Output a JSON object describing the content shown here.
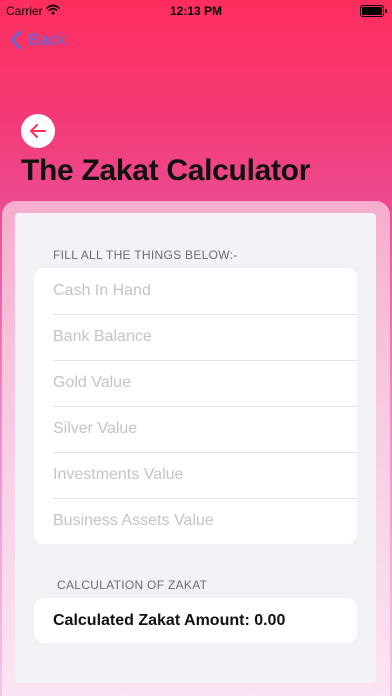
{
  "status_bar": {
    "carrier": "Carrier",
    "time": "12:13 PM"
  },
  "nav": {
    "back_label": "Back"
  },
  "page": {
    "title": "The Zakat Calculator"
  },
  "form": {
    "section_header": "FILL ALL THE THINGS BELOW:-",
    "fields": [
      {
        "placeholder": "Cash In Hand",
        "value": ""
      },
      {
        "placeholder": "Bank Balance",
        "value": ""
      },
      {
        "placeholder": "Gold Value",
        "value": ""
      },
      {
        "placeholder": "Silver Value",
        "value": ""
      },
      {
        "placeholder": "Investments Value",
        "value": ""
      },
      {
        "placeholder": "Business Assets Value",
        "value": ""
      }
    ]
  },
  "calculation": {
    "section_header": "CALCULATION OF ZAKAT",
    "result_label": "Calculated Zakat Amount: 0.00"
  },
  "colors": {
    "accent": "#ff2d5e",
    "nav_tint": "#5a6de0"
  },
  "icons": {
    "nav_back": "chevron-left-icon",
    "round_back": "arrow-left-icon"
  }
}
